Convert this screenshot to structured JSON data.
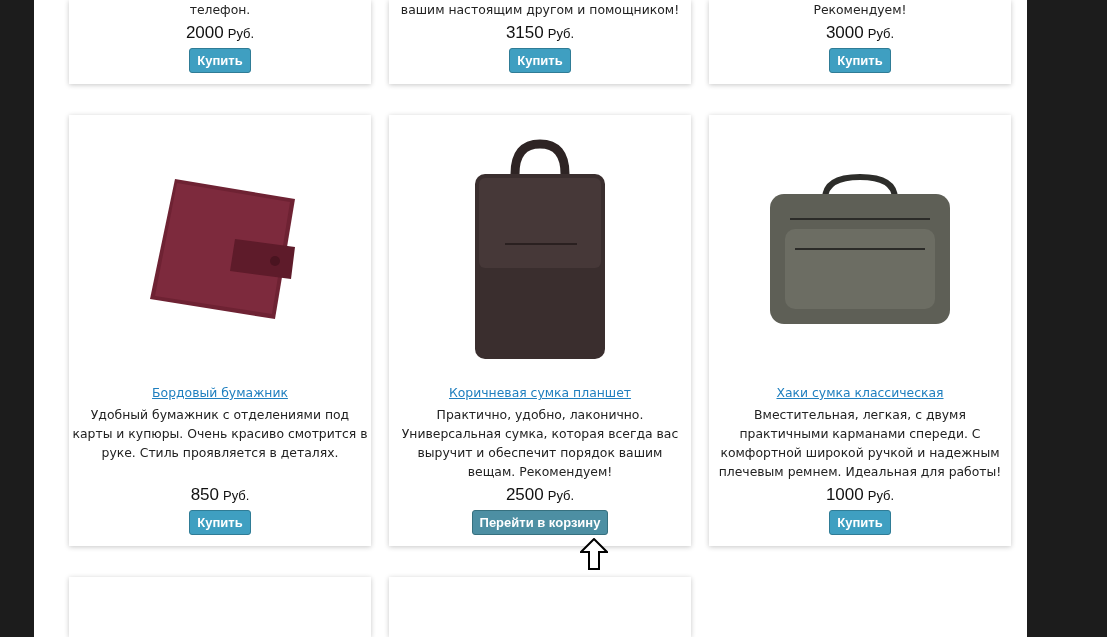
{
  "rows": [
    {
      "cards": [
        {
          "kind": "text",
          "description": "телефон.",
          "price": "2000",
          "currency": "Руб.",
          "button": {
            "label": "Купить",
            "in_cart": false
          }
        },
        {
          "kind": "text",
          "description": "вашим настоящим другом и помощником!",
          "price": "3150",
          "currency": "Руб.",
          "button": {
            "label": "Купить",
            "in_cart": false
          }
        },
        {
          "kind": "text",
          "description": "Рекомендуем!",
          "price": "3000",
          "currency": "Руб.",
          "button": {
            "label": "Купить",
            "in_cart": false
          }
        }
      ]
    },
    {
      "cards": [
        {
          "kind": "wallet",
          "title": "Бордовый бумажник",
          "description": "Удобный бумажник с отделениями под карты и купюры. Очень красиво смотрится в руке. Стиль проявляется в деталях.",
          "price": "850",
          "currency": "Руб.",
          "button": {
            "label": "Купить",
            "in_cart": false
          }
        },
        {
          "kind": "satchel",
          "title": "Коричневая сумка планшет",
          "description": "Практично, удобно, лаконично. Универсальная сумка, которая всегда вас выручит и обеспечит порядок вашим вещам. Рекомендуем!",
          "price": "2500",
          "currency": "Руб.",
          "button": {
            "label": "Перейти в корзину",
            "in_cart": true
          }
        },
        {
          "kind": "bag",
          "title": "Хаки сумка классическая",
          "description": "Вместительная, легкая, с двумя практичными карманами спереди. С комфортной широкой ручкой и надежным плечевым ремнем. Идеальная для работы!",
          "price": "1000",
          "currency": "Руб.",
          "button": {
            "label": "Купить",
            "in_cart": false
          }
        }
      ]
    },
    {
      "cards": [
        {
          "kind": "blank"
        },
        {
          "kind": "blank"
        }
      ]
    }
  ]
}
